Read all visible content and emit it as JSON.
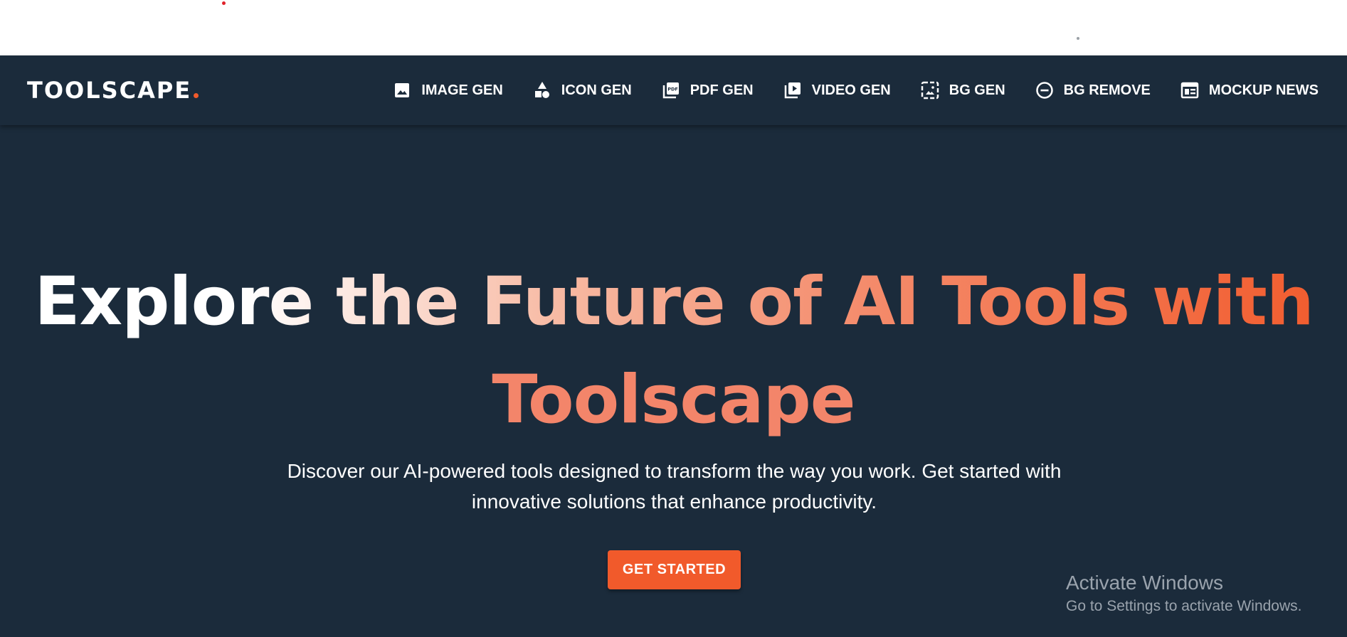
{
  "brand": {
    "logo_text": "TOOLSCAPE",
    "accent_color": "#f15a2b",
    "nav_bg": "#1b2b3b"
  },
  "nav": {
    "items": [
      {
        "label": "IMAGE GEN",
        "icon": "image-icon"
      },
      {
        "label": "ICON GEN",
        "icon": "shapes-icon"
      },
      {
        "label": "PDF GEN",
        "icon": "pdf-icon"
      },
      {
        "label": "VIDEO GEN",
        "icon": "video-library-icon"
      },
      {
        "label": "BG GEN",
        "icon": "image-frame-icon"
      },
      {
        "label": "BG REMOVE",
        "icon": "remove-circle-icon"
      },
      {
        "label": "MOCKUP NEWS",
        "icon": "newspaper-icon"
      }
    ]
  },
  "hero": {
    "headline_line1": "Explore the Future of AI Tools with",
    "headline_line2": "Toolscape",
    "subtext": "Discover our AI-powered tools designed to transform the way you work. Get started with innovative solutions that enhance productivity.",
    "cta_label": "GET STARTED"
  },
  "watermark": {
    "title": "Activate Windows",
    "subtitle": "Go to Settings to activate Windows."
  }
}
